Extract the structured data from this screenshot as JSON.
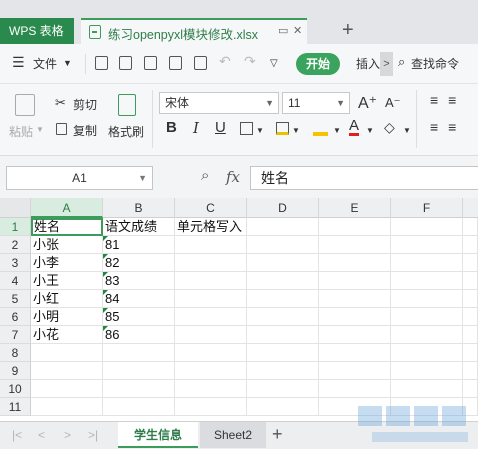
{
  "tabbar": {
    "app_tab": "WPS 表格",
    "file_tab": "练习openpyxl模块修改.xlsx",
    "new_tab": "+"
  },
  "menubar": {
    "file_menu": "文件",
    "start_button": "开始",
    "insert_menu": "插入",
    "search_command": "查找命令",
    "more_arrow": ">"
  },
  "ribbon": {
    "paste": "粘贴",
    "cut": "剪切",
    "copy": "复制",
    "format_painter": "格式刷",
    "font_name": "宋体",
    "font_size": "11",
    "font_grow": "A⁺",
    "font_shrink": "A⁻",
    "bold": "B",
    "italic": "I",
    "underline": "U",
    "font_color_glyph": "A"
  },
  "formula_bar": {
    "name_box": "A1",
    "fx": "fx",
    "value": "姓名"
  },
  "grid": {
    "columns": [
      "A",
      "B",
      "C",
      "D",
      "E",
      "F"
    ],
    "rows": [
      "1",
      "2",
      "3",
      "4",
      "5",
      "6",
      "7",
      "8",
      "9",
      "10",
      "11"
    ],
    "cells": {
      "A1": "姓名",
      "B1": "语文成绩",
      "C1": "单元格写入",
      "A2": "小张",
      "B2": "81",
      "A3": "小李",
      "B3": "82",
      "A4": "小王",
      "B4": "83",
      "A5": "小红",
      "B5": "84",
      "A6": "小明",
      "B6": "85",
      "A7": "小花",
      "B7": "86"
    }
  },
  "sheets": {
    "tabs": [
      "学生信息",
      "Sheet2"
    ],
    "add": "+",
    "nav": [
      "|<",
      "<",
      ">",
      ">|"
    ]
  },
  "colors": {
    "accent": "#3d9b5c",
    "wps_tab": "#2a8a4e",
    "start_button": "#3aa35e"
  }
}
